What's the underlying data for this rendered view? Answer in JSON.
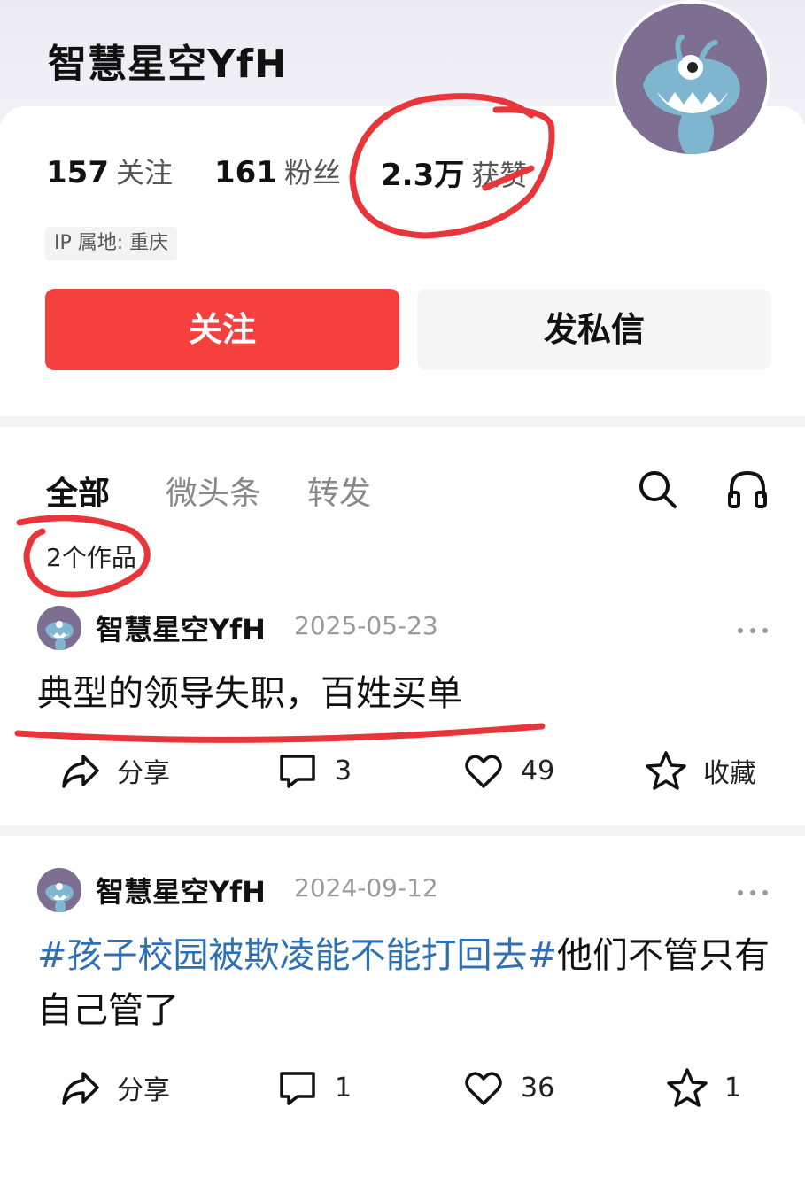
{
  "profile": {
    "username": "智慧星空YfH",
    "following_count": "157",
    "following_label": "关注",
    "followers_count": "161",
    "followers_label": "粉丝",
    "likes_count": "2.3万",
    "likes_label": "获赞",
    "ip_location": "IP 属地: 重庆",
    "avatar_icon": "blue-monster-avatar",
    "avatar_bg": "#7e6e91"
  },
  "actions": {
    "follow_label": "关注",
    "message_label": "发私信",
    "follow_color": "#f5403e"
  },
  "tabs": {
    "items": [
      {
        "label": "全部",
        "active": true
      },
      {
        "label": "微头条",
        "active": false
      },
      {
        "label": "转发",
        "active": false
      }
    ],
    "search_icon": "search-icon",
    "listen_icon": "headphones-icon"
  },
  "works_count": "2个作品",
  "posts": [
    {
      "author": "智慧星空YfH",
      "date": "2025-05-23",
      "text": "典型的领导失职，百姓买单",
      "share_label": "分享",
      "comments": "3",
      "likes": "49",
      "favorite_label": "收藏"
    },
    {
      "author": "智慧星空YfH",
      "date": "2024-09-12",
      "hashtag": "#孩子校园被欺凌能不能打回去#",
      "text": "他们不管只有自己管了",
      "share_label": "分享",
      "comments": "1",
      "likes": "36",
      "favorites": "1"
    }
  ],
  "colors": {
    "annotation_red": "#e8353a",
    "hashtag_blue": "#2f6fb3"
  }
}
